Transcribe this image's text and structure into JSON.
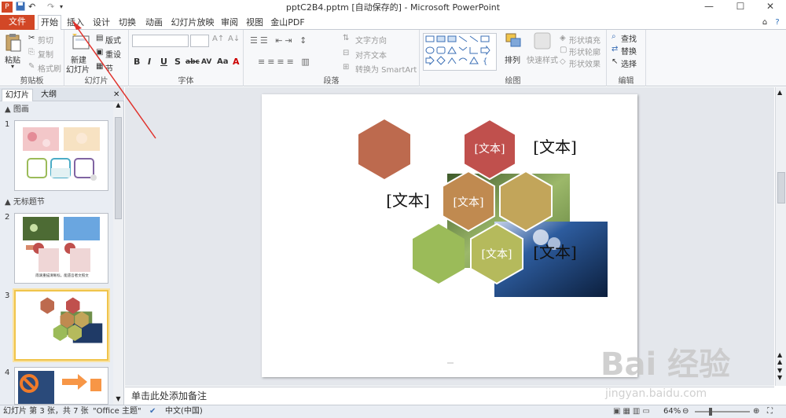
{
  "window": {
    "title": "pptC2B4.pptm [自动保存的] - Microsoft PowerPoint",
    "controls": {
      "minimize": "—",
      "maximize": "☐",
      "close": "✕"
    }
  },
  "tabs": [
    "文件",
    "开始",
    "插入",
    "设计",
    "切换",
    "动画",
    "幻灯片放映",
    "审阅",
    "视图",
    "金山PDF"
  ],
  "ribbon": {
    "clipboard": {
      "paste": "粘贴",
      "cut": "剪切",
      "copy": "复制",
      "format_painter": "格式刷",
      "label": "剪贴板"
    },
    "slides": {
      "new_slide": "新建",
      "new_slide_2": "幻灯片",
      "layout": "版式",
      "reset": "重设",
      "section": "节",
      "label": "幻灯片"
    },
    "font": {
      "label": "字体",
      "bold": "B",
      "italic": "I",
      "underline": "U",
      "shadow": "S",
      "strike": "abc",
      "spacing": "AV",
      "case": "Aa",
      "color": "A"
    },
    "paragraph": {
      "text_direction": "文字方向",
      "align_text": "对齐文本",
      "smartart": "转换为 SmartArt",
      "label": "段落"
    },
    "drawing": {
      "arrange": "排列",
      "quick_styles": "快速样式",
      "shape_fill": "形状填充",
      "shape_outline": "形状轮廓",
      "shape_effects": "形状效果",
      "label": "绘图"
    },
    "editing": {
      "find": "查找",
      "replace": "替换",
      "select": "选择",
      "label": "编辑"
    }
  },
  "panel": {
    "tabs": [
      "幻灯片",
      "大纲"
    ],
    "sections": [
      "图画",
      "无标题节"
    ],
    "slide_numbers": [
      "1",
      "2",
      "3",
      "4"
    ],
    "slide2_caption": "雨滴重描清晰标，能遗吾者文照文"
  },
  "slide": {
    "labels": [
      "[文本]",
      "[文本]",
      "[文本]",
      "[文本]",
      "[文本]",
      "[文本]"
    ],
    "colors": {
      "hex1": "#bd6a4e",
      "hex2": "#c0504d",
      "hex3": "#c08a50",
      "hex4": "#c2a55a",
      "hex5": "#9bbb59",
      "hex6": "#b5ba5c"
    }
  },
  "notes": {
    "placeholder": "单击此处添加备注"
  },
  "status": {
    "slide_info": "幻灯片 第 3 张，共 7 张",
    "theme": "\"Office 主题\"",
    "language": "中文(中国)",
    "zoom": "64%"
  },
  "watermark": {
    "brand": "Bai 经验",
    "url": "jingyan.baidu.com"
  }
}
